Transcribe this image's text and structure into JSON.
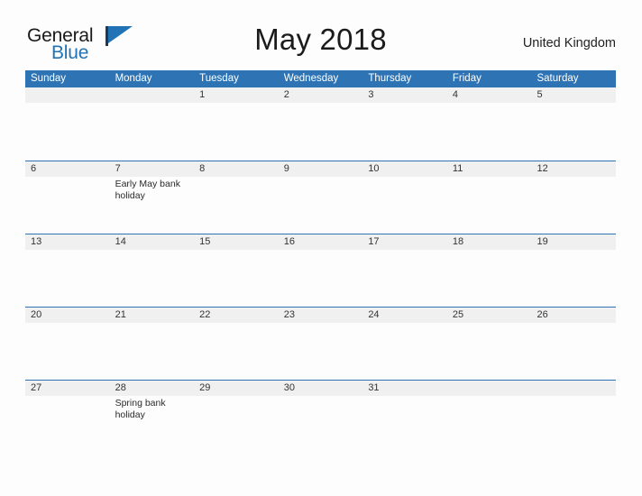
{
  "brand": {
    "name_part1": "General",
    "name_part2": "Blue",
    "flag_icon": "blue-triangle-flag-icon",
    "accent_color": "#2273b5"
  },
  "header": {
    "title": "May 2018",
    "country": "United Kingdom"
  },
  "theme": {
    "header_blue": "#2e74b5",
    "row_band_gray": "#f0f0f0",
    "page_background": "#fdfdfd"
  },
  "calendar": {
    "month": "May",
    "year": "2018",
    "weekday_headers": [
      "Sunday",
      "Monday",
      "Tuesday",
      "Wednesday",
      "Thursday",
      "Friday",
      "Saturday"
    ],
    "weeks": [
      [
        {
          "date": ""
        },
        {
          "date": ""
        },
        {
          "date": "1"
        },
        {
          "date": "2"
        },
        {
          "date": "3"
        },
        {
          "date": "4"
        },
        {
          "date": "5"
        }
      ],
      [
        {
          "date": "6"
        },
        {
          "date": "7",
          "event": "Early May bank holiday"
        },
        {
          "date": "8"
        },
        {
          "date": "9"
        },
        {
          "date": "10"
        },
        {
          "date": "11"
        },
        {
          "date": "12"
        }
      ],
      [
        {
          "date": "13"
        },
        {
          "date": "14"
        },
        {
          "date": "15"
        },
        {
          "date": "16"
        },
        {
          "date": "17"
        },
        {
          "date": "18"
        },
        {
          "date": "19"
        }
      ],
      [
        {
          "date": "20"
        },
        {
          "date": "21"
        },
        {
          "date": "22"
        },
        {
          "date": "23"
        },
        {
          "date": "24"
        },
        {
          "date": "25"
        },
        {
          "date": "26"
        }
      ],
      [
        {
          "date": "27"
        },
        {
          "date": "28",
          "event": "Spring bank holiday"
        },
        {
          "date": "29"
        },
        {
          "date": "30"
        },
        {
          "date": "31"
        },
        {
          "date": ""
        },
        {
          "date": ""
        }
      ]
    ]
  }
}
